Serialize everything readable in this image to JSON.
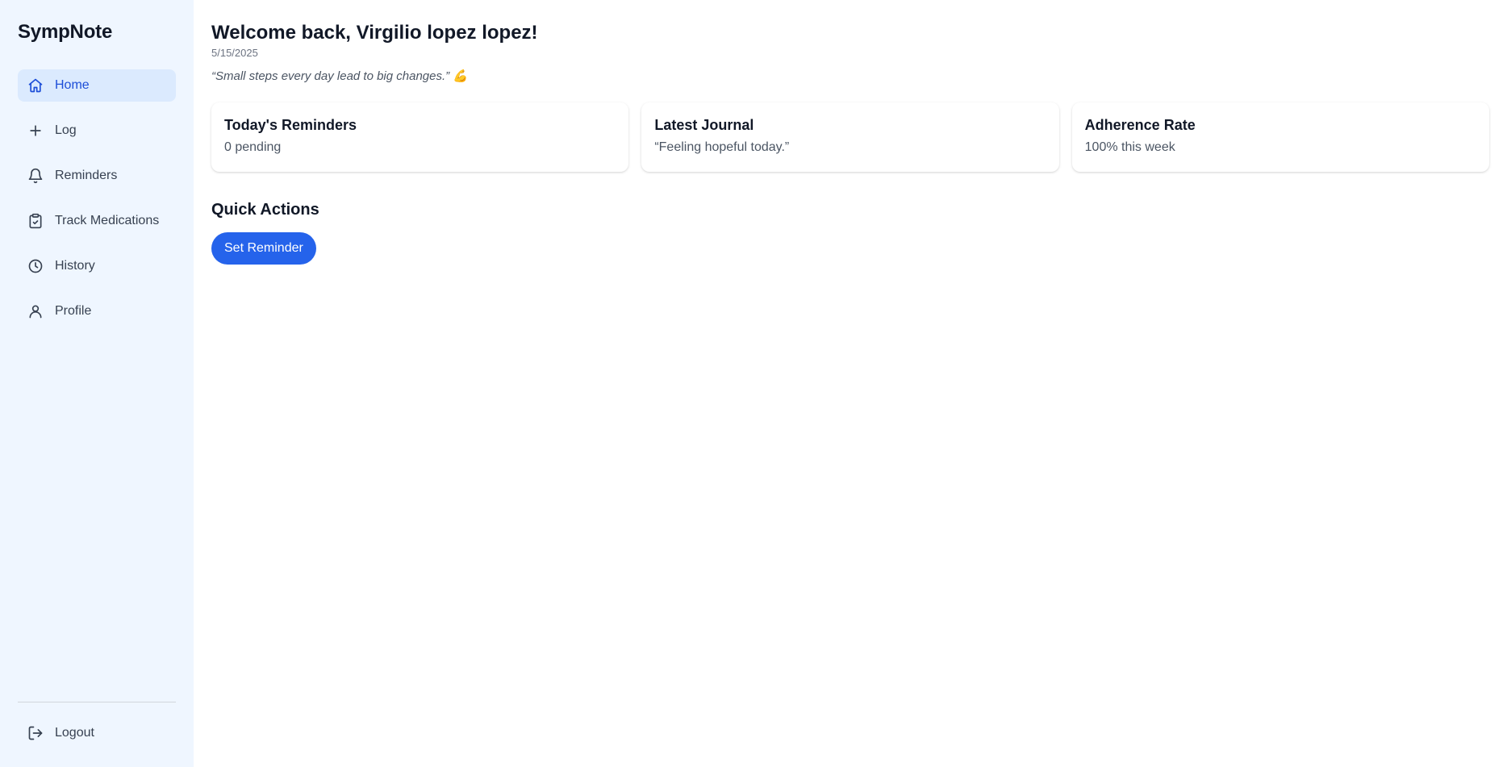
{
  "app": {
    "name": "SympNote"
  },
  "sidebar": {
    "items": [
      {
        "label": "Home",
        "icon": "home-icon",
        "active": true
      },
      {
        "label": "Log",
        "icon": "plus-icon",
        "active": false
      },
      {
        "label": "Reminders",
        "icon": "bell-icon",
        "active": false
      },
      {
        "label": "Track Medications",
        "icon": "clipboard-check-icon",
        "active": false
      },
      {
        "label": "History",
        "icon": "clock-icon",
        "active": false
      },
      {
        "label": "Profile",
        "icon": "user-icon",
        "active": false
      }
    ],
    "logout": {
      "label": "Logout",
      "icon": "logout-icon"
    }
  },
  "header": {
    "title": "Welcome back, Virgilio lopez lopez!",
    "date": "5/15/2025",
    "quote": "“Small steps every day lead to big changes.” 💪"
  },
  "cards": [
    {
      "title": "Today's Reminders",
      "value": "0 pending"
    },
    {
      "title": "Latest Journal",
      "value": "“Feeling hopeful today.”"
    },
    {
      "title": "Adherence Rate",
      "value": "100% this week"
    }
  ],
  "quick_actions": {
    "title": "Quick Actions",
    "set_reminder_label": "Set Reminder"
  },
  "colors": {
    "sidebar_bg": "#eff6ff",
    "active_bg": "#dbeafe",
    "accent": "#2563eb"
  }
}
